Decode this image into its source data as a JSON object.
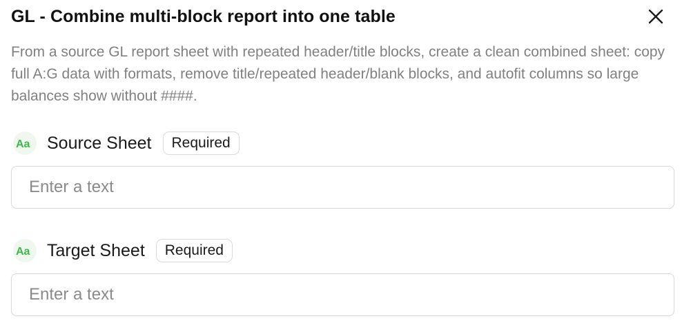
{
  "dialog": {
    "title": "GL - Combine multi-block report into one table",
    "description": "From a source GL report sheet with repeated header/title blocks, create a clean combined sheet: copy full A:G data with formats, remove title/repeated header/blank blocks, and autofit columns so large balances show without ####.",
    "close_icon": "close-icon"
  },
  "fields": [
    {
      "label": "Source Sheet",
      "badge": "Required",
      "placeholder": "Enter a text",
      "value": "",
      "type_icon": "text-type-icon",
      "type_icon_glyph": "Aa"
    },
    {
      "label": "Target Sheet",
      "badge": "Required",
      "placeholder": "Enter a text",
      "value": "",
      "type_icon": "text-type-icon",
      "type_icon_glyph": "Aa"
    }
  ],
  "colors": {
    "accent_green": "#3cb94a",
    "icon_bg": "#eef8ef",
    "description_gray": "#808080",
    "border_gray": "#d9d9d9"
  }
}
